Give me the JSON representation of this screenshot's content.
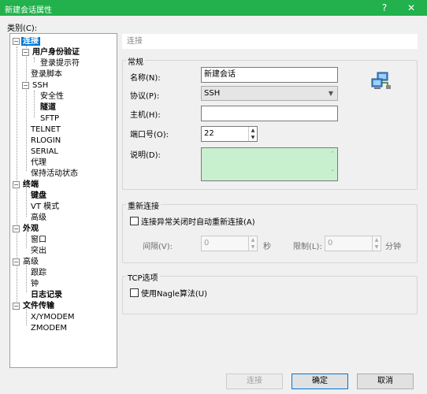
{
  "window": {
    "title": "新建会话属性",
    "help_label": "?",
    "close_label": "✕"
  },
  "category_label": "类别(C):",
  "tree": {
    "items": [
      {
        "label": "连接"
      },
      {
        "label": "用户身份验证"
      },
      {
        "label": "登录提示符"
      },
      {
        "label": "登录脚本"
      },
      {
        "label": "SSH"
      },
      {
        "label": "安全性"
      },
      {
        "label": "隧道"
      },
      {
        "label": "SFTP"
      },
      {
        "label": "TELNET"
      },
      {
        "label": "RLOGIN"
      },
      {
        "label": "SERIAL"
      },
      {
        "label": "代理"
      },
      {
        "label": "保持活动状态"
      },
      {
        "label": "终端"
      },
      {
        "label": "键盘"
      },
      {
        "label": "VT 模式"
      },
      {
        "label": "高级"
      },
      {
        "label": "外观"
      },
      {
        "label": "窗口"
      },
      {
        "label": "突出"
      },
      {
        "label": "高级"
      },
      {
        "label": "跟踪"
      },
      {
        "label": "钟"
      },
      {
        "label": "日志记录"
      },
      {
        "label": "文件传输"
      },
      {
        "label": "X/YMODEM"
      },
      {
        "label": "ZMODEM"
      }
    ]
  },
  "section_header": "连接",
  "general": {
    "title": "常规",
    "name_label": "名称(N):",
    "name_value": "新建会话",
    "protocol_label": "协议(P):",
    "protocol_value": "SSH",
    "host_label": "主机(H):",
    "host_value": "",
    "port_label": "端口号(O):",
    "port_value": "22",
    "desc_label": "说明(D):",
    "desc_value": ""
  },
  "reconnect": {
    "title": "重新连接",
    "checkbox_label": "连接异常关闭时自动重新连接(A)",
    "interval_label": "间隔(V):",
    "interval_value": "0",
    "interval_unit": "秒",
    "limit_label": "限制(L):",
    "limit_value": "0",
    "limit_unit": "分钟"
  },
  "tcp": {
    "title": "TCP选项",
    "nagle_label": "使用Nagle算法(U)"
  },
  "buttons": {
    "connect": "连接",
    "ok": "确定",
    "cancel": "取消"
  }
}
